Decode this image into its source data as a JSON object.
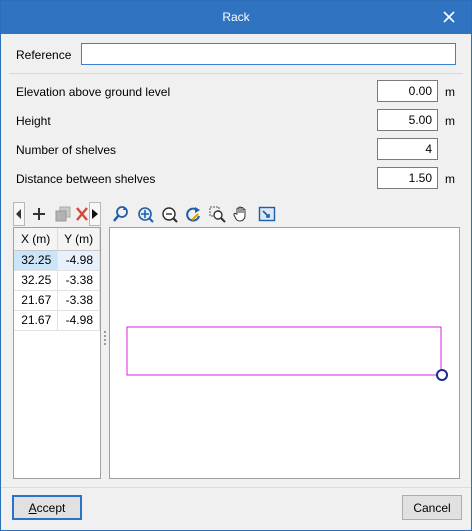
{
  "dialog": {
    "title": "Rack",
    "accept_prefix": "A",
    "accept_rest": "ccept",
    "cancel_label": "Cancel"
  },
  "form": {
    "reference_label": "Reference",
    "reference_value": "",
    "elevation_label": "Elevation above ground level",
    "elevation_value": "0.00",
    "elevation_unit": "m",
    "height_label": "Height",
    "height_value": "5.00",
    "height_unit": "m",
    "shelves_label": "Number of shelves",
    "shelves_value": "4",
    "distance_label": "Distance between shelves",
    "distance_value": "1.50",
    "distance_unit": "m"
  },
  "grid": {
    "headers": [
      "X (m)",
      "Y (m)"
    ],
    "rows": [
      [
        "32.25",
        "-4.98"
      ],
      [
        "32.25",
        "-3.38"
      ],
      [
        "21.67",
        "-3.38"
      ],
      [
        "21.67",
        "-4.98"
      ]
    ],
    "selected_row": 0
  },
  "icons": {
    "grid_toolbar": [
      "scroll-left-icon",
      "add-icon",
      "copy-icon",
      "delete-icon",
      "scroll-right-icon"
    ],
    "canvas_toolbar": [
      "zoom-previous-icon",
      "zoom-all-icon",
      "zoom-window-icon",
      "redraw-icon",
      "zoom-tool-icon",
      "pan-icon",
      "zoom-extents-icon"
    ]
  },
  "colors": {
    "title_bar": "#2f73c1",
    "shape_outline": "#e020e0",
    "vertex_marker": "#1b2a8f",
    "selection": "#cce4f7"
  }
}
